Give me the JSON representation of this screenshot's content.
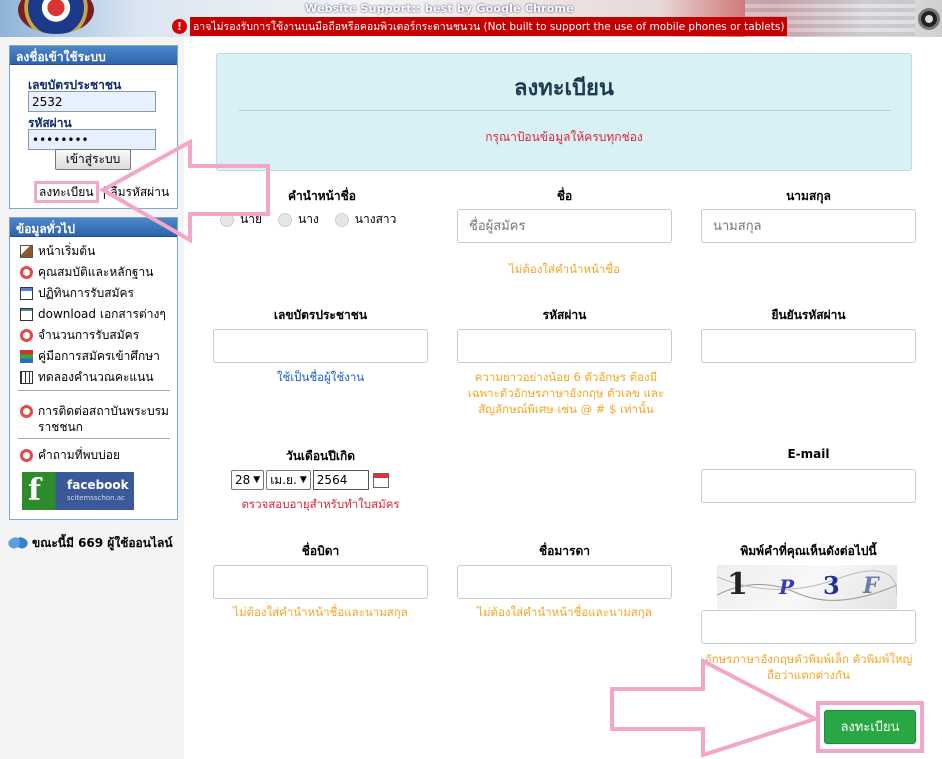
{
  "banner": {
    "support_text": "Website Support:: best by Google Chrome",
    "warning_text": "อาจไม่รองรับการใช้งานบนมือถือหรือคอมพิวเตอร์กระดานชนวน (Not built to support the use of mobile phones or tablets)"
  },
  "login_box": {
    "title": "ลงชื่อเข้าใช้ระบบ",
    "id_label": "เลขบัตรประชาชน",
    "id_value": "2532",
    "password_label": "รหัสผ่าน",
    "password_value": "••••••••",
    "login_button": "เข้าสู่ระบบ",
    "register_link": "ลงทะเบียน",
    "separator": "|",
    "forgot_link": "ลืมรหัสผ่าน"
  },
  "general_box": {
    "title": "ข้อมูลทั่วไป",
    "items": [
      {
        "label": "หน้าเริ่มต้น",
        "icon": "home-icon"
      },
      {
        "label": "คุณสมบัติและหลักฐาน",
        "icon": "lifebuoy-icon"
      },
      {
        "label": "ปฏิทินการรับสมัคร",
        "icon": "calendar-icon"
      },
      {
        "label": "download เอกสารต่างๆ",
        "icon": "document-icon"
      },
      {
        "label": "จำนวนการรับสมัคร",
        "icon": "lifebuoy-icon"
      },
      {
        "label": "คู่มือการสมัครเข้าศึกษา",
        "icon": "books-icon"
      },
      {
        "label": "ทดลองคำนวณคะแนน",
        "icon": "calculator-icon"
      },
      {
        "label": "การติดต่อสถาบันพระบรมราชชนก",
        "icon": "lifebuoy-icon"
      },
      {
        "label": "คำถามที่พบบ่อย",
        "icon": "lifebuoy-icon"
      }
    ],
    "facebook_title": "facebook",
    "facebook_sub": "scitemsschon.ac"
  },
  "online": {
    "text": "ขณะนี้มี 669 ผู้ใช้ออนไลน์"
  },
  "form": {
    "title": "ลงทะเบียน",
    "note": "กรุณาป้อนข้อมูลให้ครบทุกช่อง",
    "prefix_label": "คำนำหน้าชื่อ",
    "prefix_options": [
      "นาย",
      "นาง",
      "นางสาว"
    ],
    "firstname_label": "ชื่อ",
    "firstname_placeholder": "ชื่อผู้สมัคร",
    "firstname_hint": "ไม่ต้องใส่คำนำหน้าชื่อ",
    "lastname_label": "นามสกุล",
    "lastname_placeholder": "นามสกุล",
    "idcard_label": "เลขบัตรประชาชน",
    "idcard_hint": "ใช้เป็นชื่อผู้ใช้งาน",
    "password_label": "รหัสผ่าน",
    "password_hint": "ความยาวอย่างน้อย 6 ตัวอักษร ต้องมีเฉพาะตัวอักษรภาษาอังกฤษ ตัวเลข และสัญลักษณ์พิเศษ เช่น @ # $ เท่านั้น",
    "confirm_label": "ยืนยันรหัสผ่าน",
    "birthdate_label": "วันเดือนปีเกิด",
    "birth_day": "28",
    "birth_month": "เม.ย.",
    "birth_year": "2564",
    "birthdate_hint": "ตรวจสอบอายุสำหรับทำใบสมัคร",
    "email_label": "E-mail",
    "father_label": "ชื่อบิดา",
    "father_hint": "ไม่ต้องใส่คำนำหน้าชื่อและนามสกุล",
    "mother_label": "ชื่อมารดา",
    "mother_hint": "ไม่ต้องใส่คำนำหน้าชื่อและนามสกุล",
    "captcha_label": "พิมพ์คำที่คุณเห็นดังต่อไปนี้",
    "captcha_chars": [
      "1",
      "P",
      "3",
      "F"
    ],
    "captcha_hint": "อักษรภาษาอังกฤษตัวพิมพ์เล็ก ตัวพิมพ์ใหญ่ ถือว่าแตกต่างกัน",
    "submit_label": "ลงทะเบียน"
  },
  "colors": {
    "accent_green": "#28a745",
    "hint_orange": "#f5a623",
    "annotation_pink": "#f3a6c8"
  }
}
